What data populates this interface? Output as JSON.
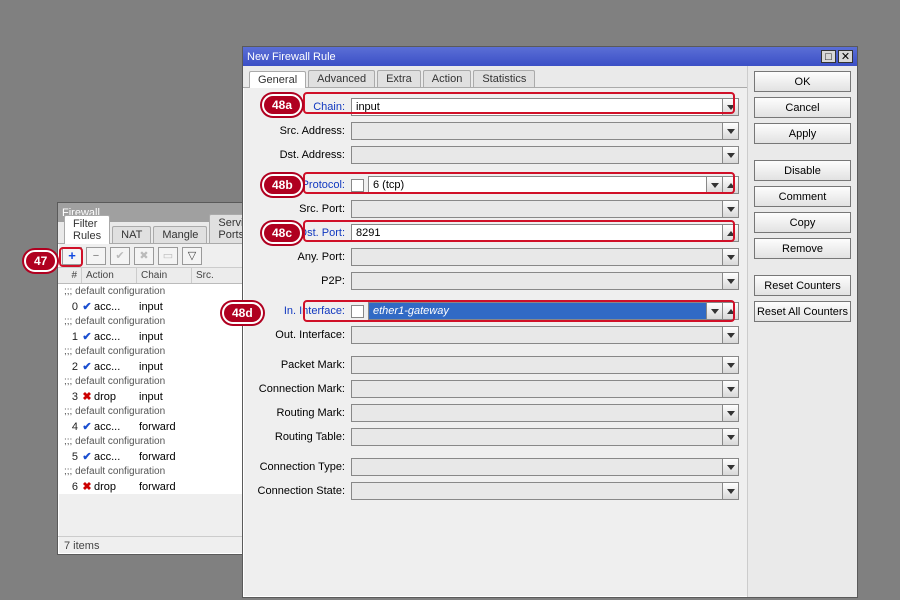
{
  "fw": {
    "title": "Firewall",
    "tabs": [
      "Filter Rules",
      "NAT",
      "Mangle",
      "Service Ports"
    ],
    "active_tab": 0,
    "cols": [
      "#",
      "Action",
      "Chain",
      "Src."
    ],
    "rows": [
      {
        "comment": ";;; default configuration"
      },
      {
        "n": "0",
        "icon": "ok",
        "action": "acc...",
        "chain": "input"
      },
      {
        "comment": ";;; default configuration"
      },
      {
        "n": "1",
        "icon": "ok",
        "action": "acc...",
        "chain": "input"
      },
      {
        "comment": ";;; default configuration"
      },
      {
        "n": "2",
        "icon": "ok",
        "action": "acc...",
        "chain": "input"
      },
      {
        "comment": ";;; default configuration"
      },
      {
        "n": "3",
        "icon": "drop",
        "action": "drop",
        "chain": "input"
      },
      {
        "comment": ";;; default configuration"
      },
      {
        "n": "4",
        "icon": "ok",
        "action": "acc...",
        "chain": "forward"
      },
      {
        "comment": ";;; default configuration"
      },
      {
        "n": "5",
        "icon": "ok",
        "action": "acc...",
        "chain": "forward"
      },
      {
        "comment": ";;; default configuration"
      },
      {
        "n": "6",
        "icon": "drop",
        "action": "drop",
        "chain": "forward"
      }
    ],
    "status": "7 items"
  },
  "rule": {
    "title": "New Firewall Rule",
    "tabs": [
      "General",
      "Advanced",
      "Extra",
      "Action",
      "Statistics"
    ],
    "active_tab": 0,
    "buttons": [
      "OK",
      "Cancel",
      "Apply",
      "Disable",
      "Comment",
      "Copy",
      "Remove",
      "Reset Counters",
      "Reset All Counters"
    ],
    "fields": {
      "chain": {
        "label": "Chain:",
        "value": "input"
      },
      "src_addr": {
        "label": "Src. Address:",
        "value": ""
      },
      "dst_addr": {
        "label": "Dst. Address:",
        "value": ""
      },
      "protocol": {
        "label": "Protocol:",
        "value": "6 (tcp)"
      },
      "src_port": {
        "label": "Src. Port:",
        "value": ""
      },
      "dst_port": {
        "label": "Dst. Port:",
        "value": "8291"
      },
      "any_port": {
        "label": "Any. Port:",
        "value": ""
      },
      "p2p": {
        "label": "P2P:",
        "value": ""
      },
      "in_if": {
        "label": "In. Interface:",
        "value": "ether1-gateway"
      },
      "out_if": {
        "label": "Out. Interface:",
        "value": ""
      },
      "pkt_mark": {
        "label": "Packet Mark:",
        "value": ""
      },
      "conn_mark": {
        "label": "Connection Mark:",
        "value": ""
      },
      "route_mark": {
        "label": "Routing Mark:",
        "value": ""
      },
      "route_tbl": {
        "label": "Routing Table:",
        "value": ""
      },
      "conn_type": {
        "label": "Connection Type:",
        "value": ""
      },
      "conn_state": {
        "label": "Connection State:",
        "value": ""
      }
    }
  },
  "callouts": {
    "c47": "47",
    "c48a": "48a",
    "c48b": "48b",
    "c48c": "48c",
    "c48d": "48d"
  },
  "icons": {
    "plus": "+",
    "minus": "−",
    "check": "✔",
    "cross": "✖",
    "filter": "▼",
    "square": "□",
    "close": "✕"
  }
}
